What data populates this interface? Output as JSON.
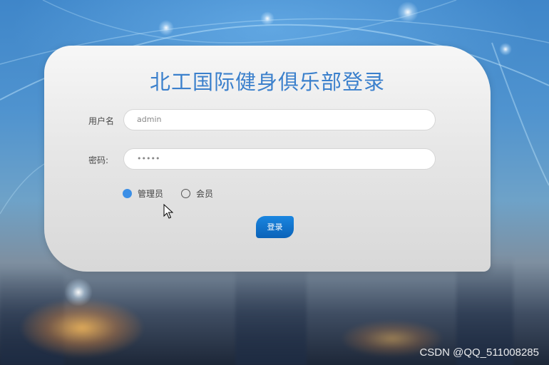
{
  "login": {
    "title": "北工国际健身俱乐部登录",
    "username_label": "用户名",
    "username_value": "admin",
    "password_label": "密码:",
    "password_value": "•••••",
    "roles": [
      {
        "label": "管理员",
        "checked": true
      },
      {
        "label": "会员",
        "checked": false
      }
    ],
    "submit_label": "登录"
  },
  "watermark": "CSDN @QQ_511008285",
  "colors": {
    "title": "#3b80cc",
    "accent": "#3c8fe6",
    "button": "#0b6fcc"
  }
}
